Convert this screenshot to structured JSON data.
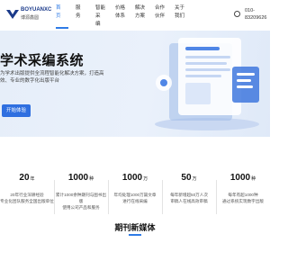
{
  "brand": {
    "name": "BOYUANXC",
    "sub": "博源鑫圆"
  },
  "nav": {
    "items": [
      {
        "label": "首\n页",
        "active": true
      },
      {
        "label": "服\n务",
        "active": false
      },
      {
        "label": "智能\n采\n编",
        "active": false
      },
      {
        "label": "价格\n体系",
        "active": false
      },
      {
        "label": "解决\n方案",
        "active": false
      },
      {
        "label": "合作\n伙伴",
        "active": false
      },
      {
        "label": "关于\n我们",
        "active": false
      }
    ]
  },
  "contact": {
    "phone": "010-\n83209626"
  },
  "hero": {
    "title": "学术采编系统",
    "description": "为学术出版提供全流程智能化解决方案，打造高效、专业的数字化出版平台",
    "button_label": "开始体验"
  },
  "stats": [
    {
      "value": "20",
      "unit": "年",
      "desc": "20年行业深耕经验\n专业化团队服务全国出版单位"
    },
    {
      "value": "1000",
      "unit": "种",
      "desc": "累计1000余种期刊与图书出版\n使用公司产品和服务"
    },
    {
      "value": "1000",
      "unit": "万",
      "desc": "年均处理1000万篇文章\n进行在线采编"
    },
    {
      "value": "50",
      "unit": "万",
      "desc": "每年新增超50万人次\n审稿人在线高效审稿"
    },
    {
      "value": "1000",
      "unit": "种",
      "desc": "每年有超1000种\n通过系统实现数字出版"
    }
  ],
  "section": {
    "title": "期刊新媒体"
  },
  "colors": {
    "accent": "#2f7be6",
    "button": "#2f6fe0",
    "hero_bg": "#e6eef9"
  }
}
